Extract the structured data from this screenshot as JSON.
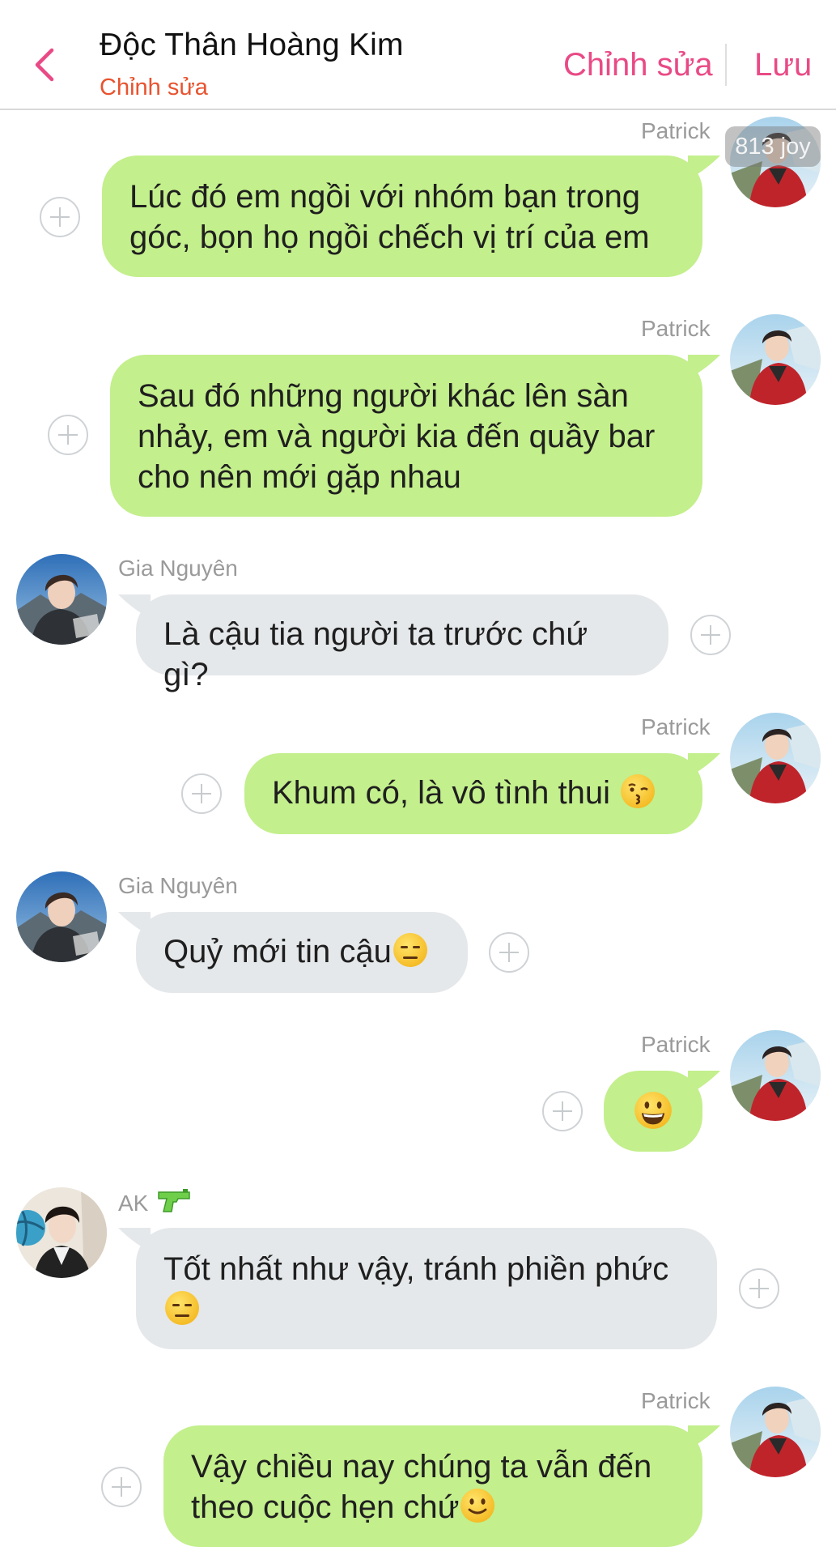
{
  "header": {
    "title": "Độc Thân Hoàng Kim",
    "subtitle": "Chỉnh sửa",
    "edit_label": "Chỉnh sửa",
    "save_label": "Lưu"
  },
  "watermark": "813 joy",
  "messages": [
    {
      "sender": "Patrick",
      "direction": "out",
      "text": "Lúc đó em ngồi với nhóm bạn trong góc, bọn họ ngồi chếch vị trí của em"
    },
    {
      "sender": "Patrick",
      "direction": "out",
      "text": "Sau đó những người khác lên sàn nhảy, em và người kia đến quầy bar cho nên mới gặp nhau"
    },
    {
      "sender": "Gia Nguyên",
      "direction": "in",
      "text": "Là cậu tia người ta trước chứ gì?"
    },
    {
      "sender": "Patrick",
      "direction": "out",
      "text": "Khum có, là vô tình thui",
      "emoji": "kissing-face"
    },
    {
      "sender": "Gia Nguyên",
      "direction": "in",
      "text": "Quỷ mới tin cậu",
      "emoji": "expressionless-face"
    },
    {
      "sender": "Patrick",
      "direction": "out",
      "text": "",
      "emoji": "grinning-face"
    },
    {
      "sender": "AK",
      "direction": "in",
      "text": "Tốt nhất như vậy, tránh phiền phức",
      "emoji": "expressionless-face",
      "name_icon": "water-gun-icon"
    },
    {
      "sender": "Patrick",
      "direction": "out",
      "text": "Vậy chiều nay chúng ta vẫn đến theo cuộc hẹn chứ",
      "emoji": "slightly-smiling-face"
    }
  ],
  "colors": {
    "accent": "#e94a86",
    "subtitle": "#e8532f",
    "outgoing_bubble": "#c3ef8c",
    "incoming_bubble": "#e5e8ea"
  }
}
